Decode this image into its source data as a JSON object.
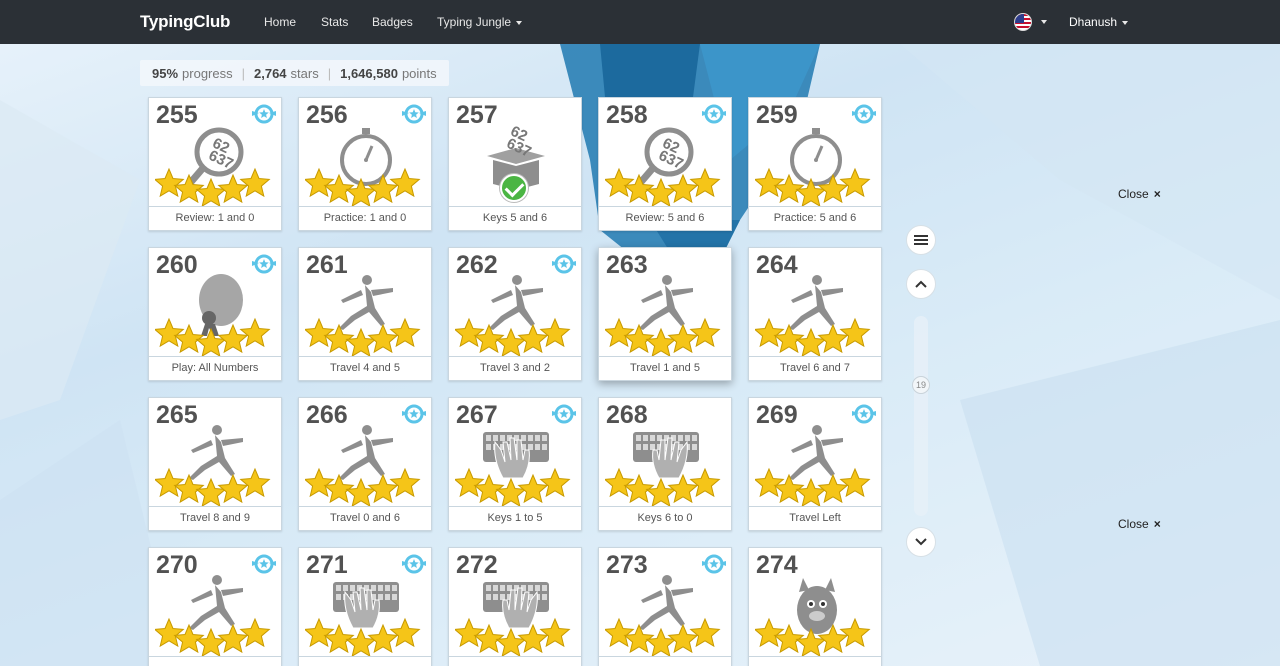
{
  "nav": {
    "brand": "TypingClub",
    "links": [
      "Home",
      "Stats",
      "Badges",
      "Typing Jungle"
    ],
    "user": "Dhanush"
  },
  "progress": {
    "percent": "95%",
    "percent_label": "progress",
    "stars": "2,764",
    "stars_label": "stars",
    "points": "1,646,580",
    "points_label": "points"
  },
  "lessons": [
    {
      "num": "255",
      "label": "Review: 1 and 0",
      "icon": "magnifier-numbers-icon",
      "badge": true,
      "stars": 5
    },
    {
      "num": "256",
      "label": "Practice: 1 and 0",
      "icon": "stopwatch-icon",
      "badge": true,
      "stars": 5
    },
    {
      "num": "257",
      "label": "Keys 5 and 6",
      "icon": "number-box-icon",
      "badge": false,
      "stars": 0,
      "completed": true
    },
    {
      "num": "258",
      "label": "Review: 5 and 6",
      "icon": "magnifier-numbers-icon",
      "badge": true,
      "stars": 5
    },
    {
      "num": "259",
      "label": "Practice: 5 and 6",
      "icon": "stopwatch-icon",
      "badge": true,
      "stars": 5
    },
    {
      "num": "260",
      "label": "Play: All Numbers",
      "icon": "game-character-icon",
      "badge": true,
      "stars": 5
    },
    {
      "num": "261",
      "label": "Travel 4 and 5",
      "icon": "runner-icon",
      "badge": false,
      "stars": 5
    },
    {
      "num": "262",
      "label": "Travel 3 and 2",
      "icon": "runner-icon",
      "badge": true,
      "stars": 5
    },
    {
      "num": "263",
      "label": "Travel 1 and 5",
      "icon": "runner-icon",
      "badge": false,
      "stars": 5
    },
    {
      "num": "264",
      "label": "Travel 6 and 7",
      "icon": "runner-icon",
      "badge": false,
      "stars": 5
    },
    {
      "num": "265",
      "label": "Travel 8 and 9",
      "icon": "runner-icon",
      "badge": false,
      "stars": 5
    },
    {
      "num": "266",
      "label": "Travel 0 and 6",
      "icon": "runner-icon",
      "badge": true,
      "stars": 5
    },
    {
      "num": "267",
      "label": "Keys 1 to 5",
      "icon": "keyboard-left-hand-icon",
      "badge": true,
      "stars": 5
    },
    {
      "num": "268",
      "label": "Keys 6 to 0",
      "icon": "keyboard-right-hand-icon",
      "badge": false,
      "stars": 5
    },
    {
      "num": "269",
      "label": "Travel Left",
      "icon": "runner-icon",
      "badge": true,
      "stars": 5
    },
    {
      "num": "270",
      "label": "",
      "icon": "runner-icon",
      "badge": true,
      "stars": 5
    },
    {
      "num": "271",
      "label": "",
      "icon": "keyboard-left-hand-icon",
      "badge": true,
      "stars": 5
    },
    {
      "num": "272",
      "label": "",
      "icon": "keyboard-right-hand-icon",
      "badge": false,
      "stars": 5
    },
    {
      "num": "273",
      "label": "",
      "icon": "runner-icon",
      "badge": true,
      "stars": 5
    },
    {
      "num": "274",
      "label": "",
      "icon": "monster-icon",
      "badge": false,
      "stars": 5
    }
  ],
  "sidebar": {
    "close_label": "Close",
    "close_symbol": "×",
    "scroll_value": "19"
  },
  "colors": {
    "navbar": "#2b3036",
    "star": "#f5c518",
    "badge": "#5bc4e8",
    "check": "#4bb543"
  }
}
